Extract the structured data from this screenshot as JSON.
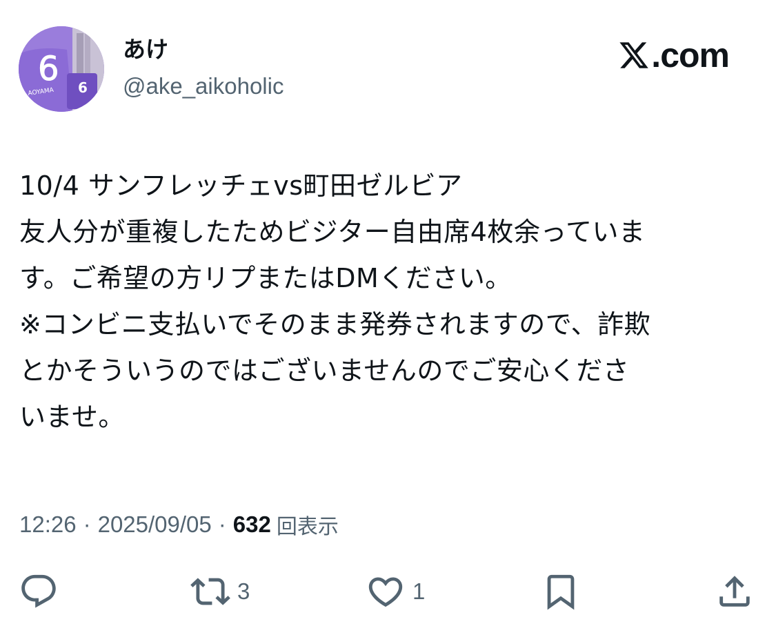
{
  "author": {
    "display_name": "あけ",
    "handle": "@ake_aikoholic",
    "avatar_jersey_number": "6",
    "avatar_jersey_name": "AOYAMA"
  },
  "brand": {
    "site": ".com",
    "logo": "x-logo-icon"
  },
  "tweet": {
    "lines": [
      "10/4 サンフレッチェvs町田ゼルビア",
      "友人分が重複したためビジター自由席4枚余っていま",
      "す。ご希望の方リプまたはDMください。",
      "※コンビニ支払いでそのまま発券されますので、詐欺",
      "とかそういうのではございませんのでご安心くださ",
      "いませ。"
    ]
  },
  "meta": {
    "time": "12:26",
    "separator": "·",
    "date": "2025/09/05",
    "views_count": "632",
    "views_label": "回表示"
  },
  "actions": {
    "reply_icon": "reply-icon",
    "retweet_icon": "retweet-icon",
    "retweet_count": "3",
    "like_icon": "heart-icon",
    "like_count": "1",
    "bookmark_icon": "bookmark-icon",
    "share_icon": "share-icon"
  },
  "colors": {
    "text": "#0f1419",
    "secondary": "#536471",
    "avatar_purple": "#8a63d2"
  }
}
